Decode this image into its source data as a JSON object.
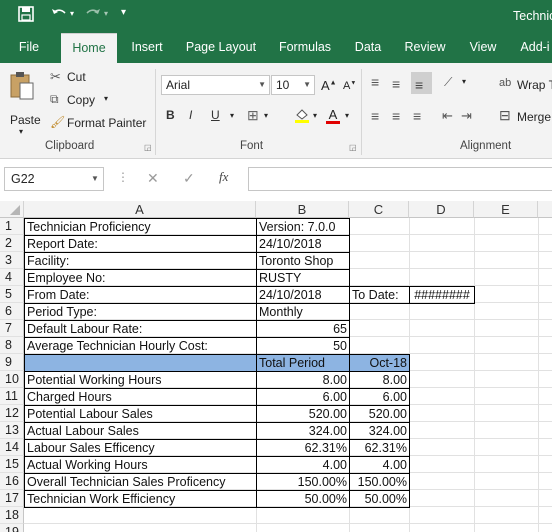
{
  "title_bar": {
    "app_title": "Technic",
    "save_icon": "save-icon",
    "undo_icon": "undo-icon",
    "redo_icon": "redo-icon"
  },
  "tabs": [
    "File",
    "Home",
    "Insert",
    "Page Layout",
    "Formulas",
    "Data",
    "Review",
    "View",
    "Add-i"
  ],
  "ribbon": {
    "paste": "Paste",
    "cut": "Cut",
    "copy": "Copy",
    "format_painter": "Format Painter",
    "clipboard_group": "Clipboard",
    "font_name": "Arial",
    "font_size": "10",
    "font_group": "Font",
    "bold": "B",
    "italic": "I",
    "underline": "U",
    "grow_font": "A",
    "shrink_font": "A",
    "font_color_letter": "A",
    "wrap": "Wrap T",
    "merge": "Merge",
    "alignment_group": "Alignment"
  },
  "formula_bar": {
    "name_box": "G22",
    "fx": "fx",
    "cancel": "✕",
    "enter": "✓",
    "value": ""
  },
  "columns": [
    "A",
    "B",
    "C",
    "D",
    "E"
  ],
  "rows": [
    {
      "n": "1",
      "a": "Technician Proficiency",
      "b": "Version: 7.0.0",
      "c": "",
      "d": ""
    },
    {
      "n": "2",
      "a": "Report Date:",
      "b": "24/10/2018",
      "c": "",
      "d": ""
    },
    {
      "n": "3",
      "a": "Facility:",
      "b": "Toronto Shop",
      "c": "",
      "d": ""
    },
    {
      "n": "4",
      "a": "Employee No:",
      "b": "RUSTY",
      "c": "",
      "d": ""
    },
    {
      "n": "5",
      "a": "From Date:",
      "b": "24/10/2018",
      "c": "To Date:",
      "d": "########"
    },
    {
      "n": "6",
      "a": "Period Type:",
      "b": "Monthly",
      "c": "",
      "d": ""
    },
    {
      "n": "7",
      "a": "Default Labour Rate:",
      "b": "65",
      "c": "",
      "d": ""
    },
    {
      "n": "8",
      "a": "Average Technician Hourly Cost:",
      "b": "50",
      "c": "",
      "d": ""
    },
    {
      "n": "9",
      "a": "",
      "b": "Total Period",
      "c": "Oct-18",
      "d": ""
    },
    {
      "n": "10",
      "a": "Potential Working Hours",
      "b": "8.00",
      "c": "8.00",
      "d": ""
    },
    {
      "n": "11",
      "a": "Charged Hours",
      "b": "6.00",
      "c": "6.00",
      "d": ""
    },
    {
      "n": "12",
      "a": "Potential Labour Sales",
      "b": "520.00",
      "c": "520.00",
      "d": ""
    },
    {
      "n": "13",
      "a": "Actual Labour Sales",
      "b": "324.00",
      "c": "324.00",
      "d": ""
    },
    {
      "n": "14",
      "a": "Labour Sales Efficency",
      "b": "62.31%",
      "c": "62.31%",
      "d": ""
    },
    {
      "n": "15",
      "a": "Actual Working Hours",
      "b": "4.00",
      "c": "4.00",
      "d": ""
    },
    {
      "n": "16",
      "a": "Overall Technician Sales Proficency",
      "b": "150.00%",
      "c": "150.00%",
      "d": ""
    },
    {
      "n": "17",
      "a": "Technician Work Efficiency",
      "b": "50.00%",
      "c": "50.00%",
      "d": ""
    },
    {
      "n": "18",
      "a": "",
      "b": "",
      "c": "",
      "d": ""
    },
    {
      "n": "19",
      "a": "",
      "b": "",
      "c": "",
      "d": ""
    }
  ],
  "colors": {
    "excel_green": "#217346",
    "header_fill": "#8db4e2"
  }
}
